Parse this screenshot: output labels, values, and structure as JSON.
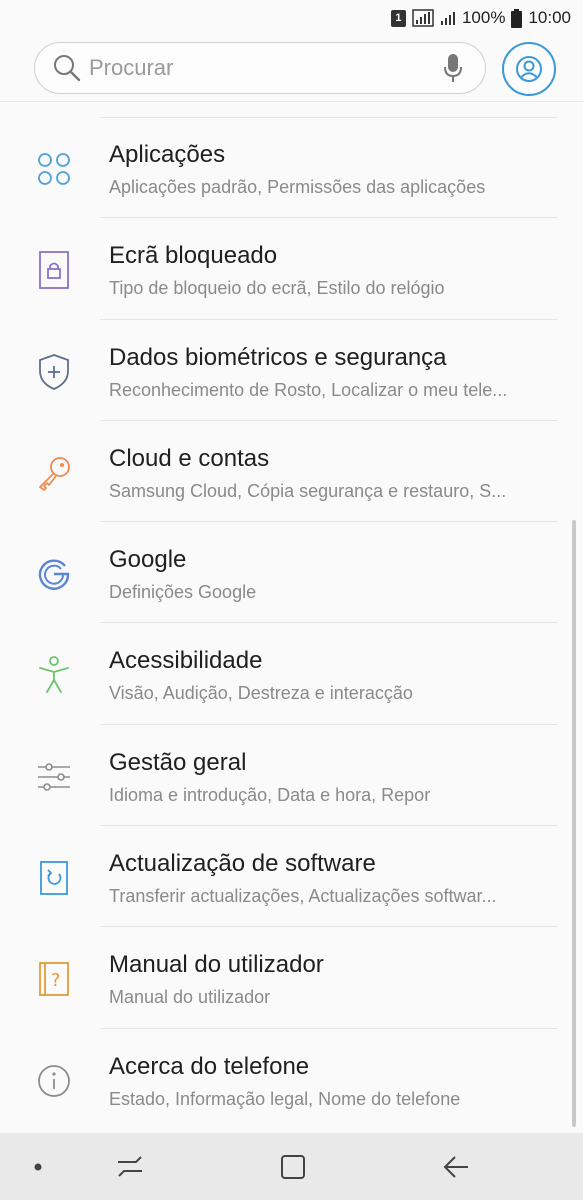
{
  "status_bar": {
    "sim": "1",
    "battery": "100%",
    "time": "10:00"
  },
  "search": {
    "placeholder": "Procurar"
  },
  "items": [
    {
      "title": "Aplicações",
      "subtitle": "Aplicações padrão, Permissões das aplicações",
      "icon": "apps-icon",
      "color": "#4fa3d9"
    },
    {
      "title": "Ecrã bloqueado",
      "subtitle": "Tipo de bloqueio do ecrã, Estilo do relógio",
      "icon": "lock-screen-icon",
      "color": "#8a73c9"
    },
    {
      "title": "Dados biométricos e segurança",
      "subtitle": "Reconhecimento de Rosto, Localizar o meu tele...",
      "icon": "shield-icon",
      "color": "#5d6f8f"
    },
    {
      "title": "Cloud e contas",
      "subtitle": "Samsung Cloud, Cópia segurança e restauro, S...",
      "icon": "key-icon",
      "color": "#ef8c4e"
    },
    {
      "title": "Google",
      "subtitle": "Definições Google",
      "icon": "google-icon",
      "color": "#5b86d6"
    },
    {
      "title": "Acessibilidade",
      "subtitle": "Visão, Audição, Destreza e interacção",
      "icon": "accessibility-icon",
      "color": "#6cc56c"
    },
    {
      "title": "Gestão geral",
      "subtitle": "Idioma e introdução, Data e hora, Repor",
      "icon": "sliders-icon",
      "color": "#8c8c8c"
    },
    {
      "title": "Actualização de software",
      "subtitle": "Transferir actualizações, Actualizações softwar...",
      "icon": "software-update-icon",
      "color": "#3a9ad9"
    },
    {
      "title": "Manual do utilizador",
      "subtitle": "Manual do utilizador",
      "icon": "user-manual-icon",
      "color": "#e49a3a"
    },
    {
      "title": "Acerca do telefone",
      "subtitle": "Estado, Informação legal, Nome do telefone",
      "icon": "info-icon",
      "color": "#8c8c8c"
    }
  ],
  "nav": {
    "icons": [
      "dot-icon",
      "recents-icon",
      "home-icon",
      "back-icon"
    ]
  }
}
